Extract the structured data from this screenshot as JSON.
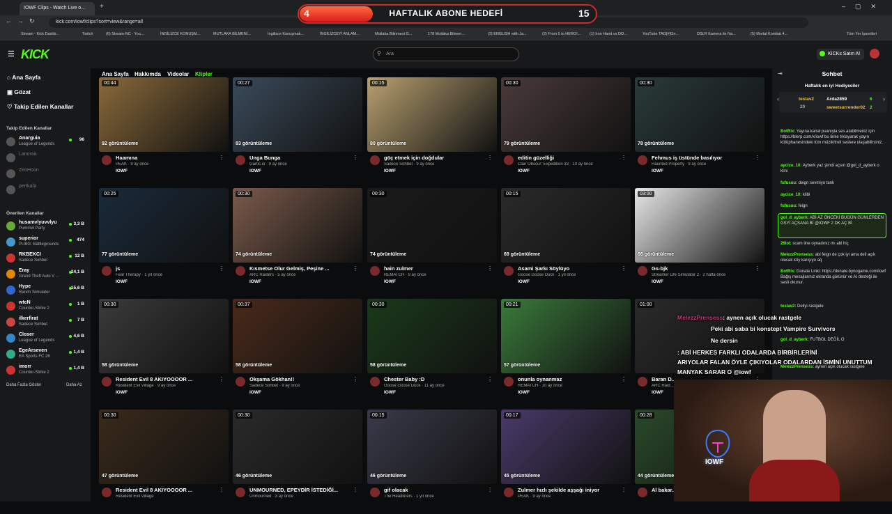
{
  "browser": {
    "tab_title": "IOWF Clips - Watch Live o...",
    "url": "kick.com/iowf/clips?sort=view&range=all",
    "bookmarks": [
      "Stream - Kick Dashb...",
      "Twitch",
      "(6) Stream-NC - You...",
      "İNGİLİZCE KONUŞM...",
      "MUTLAKA BİLMENİ...",
      "İngilizce Konuşmak...",
      "İNGİLİZCEYİ ANLAM...",
      "Mutlaka Bilinmesi G...",
      "178 Mutlaka Bilmen...",
      "(2) ENGLISH with Ja...",
      "(2) From 0 to HERO!...",
      "(1) Iron Hand vs DO...",
      "YouTube TAG[#]Ge...",
      "DSLR Kamera ile Na...",
      "(5) Mortal Kombat 4...",
      "Tüm Yer İşaretleri"
    ]
  },
  "overlay_goal": {
    "current": "4",
    "title": "HAFTALIK ABONE HEDEFİ",
    "target": "15",
    "progress": 0.27
  },
  "header": {
    "logo": "KICK",
    "search_placeholder": "Ara",
    "kicks_button": "KICKs Satın Al"
  },
  "sidebar": {
    "nav": [
      "Ana Sayfa",
      "Gözat",
      "Takip Edilen Kanallar"
    ],
    "followed_title": "Takip Edilen Kanallar",
    "followed": [
      {
        "name": "Anarguia",
        "game": "League of Legends",
        "viewers": "96",
        "live": true
      },
      {
        "name": "Lanoraa",
        "game": "",
        "viewers": "",
        "live": false
      },
      {
        "name": "ZenHoon",
        "game": "",
        "viewers": "",
        "live": false
      },
      {
        "name": "pertkafa",
        "game": "",
        "viewers": "",
        "live": false
      }
    ],
    "recommended_title": "Önerilen Kanallar",
    "recommended": [
      {
        "name": "husamvlyuvvlyu",
        "game": "Pummel Party",
        "viewers": "3,3 B"
      },
      {
        "name": "superior",
        "game": "PUBG: Battlegrounds",
        "viewers": "474"
      },
      {
        "name": "RKBEKCI",
        "game": "Sadece Sohbet",
        "viewers": "12 B"
      },
      {
        "name": "Eray",
        "game": "Grand Theft Auto V ...",
        "viewers": "24,1 B"
      },
      {
        "name": "Hype",
        "game": "Ranch Simulator",
        "viewers": "15,6 B"
      },
      {
        "name": "wtcN",
        "game": "Counter-Strike 2",
        "viewers": "1 B"
      },
      {
        "name": "ilkerfirat",
        "game": "Sadece Sohbet",
        "viewers": "7 B"
      },
      {
        "name": "Closer",
        "game": "League of Legends",
        "viewers": "4,6 B"
      },
      {
        "name": "EgeArseven",
        "game": "EA Sports FC 26",
        "viewers": "1,4 B"
      },
      {
        "name": "imorr",
        "game": "Counter-Strike 2",
        "viewers": "1,4 B"
      }
    ],
    "show_more": "Daha Fazla Göster",
    "show_less": "Daha Az"
  },
  "channel_tabs": [
    "Ana Sayfa",
    "Hakkımda",
    "Videolar",
    "Klipler"
  ],
  "clips": [
    {
      "dur": "00:44",
      "views": "92 görüntüleme",
      "title": "Haamına",
      "sub": "PEAK · 9 ay önce",
      "ch": "IOWF",
      "bg": "#8a6a3a"
    },
    {
      "dur": "00:27",
      "views": "83 görüntüleme",
      "title": "Unga Bunga",
      "sub": "Gartic.io · 9 ay önce",
      "ch": "IOWF",
      "bg": "#3a4a5a"
    },
    {
      "dur": "00:15",
      "views": "80 görüntüleme",
      "title": "göç etmek için doğdular",
      "sub": "Sadece Sohbet · 9 ay önce",
      "ch": "IOWF",
      "bg": "#b8a070"
    },
    {
      "dur": "00:30",
      "views": "79 görüntüleme",
      "title": "editin güzelliği",
      "sub": "Clair Obscur: Expedition 33 · 10 ay önce",
      "ch": "IOWF",
      "bg": "#4a3a3a"
    },
    {
      "dur": "00:30",
      "views": "78 görüntüleme",
      "title": "Fehmus iş üstünde basılıyor",
      "sub": "Haunted Property · 9 ay önce",
      "ch": "IOWF",
      "bg": "#2a3a3a"
    },
    {
      "dur": "00:25",
      "views": "77 görüntüleme",
      "title": "js",
      "sub": "Fear Therapy · 1 yıl önce",
      "ch": "IOWF",
      "bg": "#1a2a3a"
    },
    {
      "dur": "00:30",
      "views": "74 görüntüleme",
      "title": "Kısmetse Olur Gelmiş, Peşine ...",
      "sub": "ARC Raiders · 5 ay önce",
      "ch": "IOWF",
      "bg": "#7a5a4a"
    },
    {
      "dur": "00:30",
      "views": "74 görüntüleme",
      "title": "hain zulmer",
      "sub": "REMATCH · 9 ay önce",
      "ch": "IOWF",
      "bg": "#1a1a1a"
    },
    {
      "dur": "00:15",
      "views": "69 görüntüleme",
      "title": "Asami Şarkı Söylüyo",
      "sub": "Goose Goose Duck · 1 yıl önce",
      "ch": "IOWF",
      "bg": "#2a2a2a"
    },
    {
      "dur": "03:00",
      "views": "66 görüntüleme",
      "title": "Gs-bjk",
      "sub": "Streamer Life Simulator 2 · 2 hafta önce",
      "ch": "IOWF",
      "bg": "#e8e8e8"
    },
    {
      "dur": "00:30",
      "views": "58 görüntüleme",
      "title": "Resident Evil 8 AKIYOOOOR ...",
      "sub": "Resident Evil Village · 9 ay önce",
      "ch": "IOWF",
      "bg": "#3a3a3a"
    },
    {
      "dur": "00:37",
      "views": "58 görüntüleme",
      "title": "Okşama Gökhan!!",
      "sub": "Sadece Sohbet · 9 ay önce",
      "ch": "IOWF",
      "bg": "#4a2a1a"
    },
    {
      "dur": "00:30",
      "views": "58 görüntüleme",
      "title": "Chester Baby :D",
      "sub": "Goose Goose Duck · 11 ay önce",
      "ch": "IOWF",
      "bg": "#1a3a1a"
    },
    {
      "dur": "00:21",
      "views": "57 görüntüleme",
      "title": "onunla oynanmaz",
      "sub": "REMATCH · 10 ay önce",
      "ch": "IOWF",
      "bg": "#3a7a3a"
    },
    {
      "dur": "01:00",
      "views": "",
      "title": "Baran D...",
      "sub": "ARC Raid...",
      "ch": "IOWF",
      "bg": "#2a2a2a"
    },
    {
      "dur": "00:30",
      "views": "47 görüntüleme",
      "title": "Resident Evil 8 AKIYOOOOR ...",
      "sub": "Resident Evil Village",
      "ch": "",
      "bg": "#3a2a1a"
    },
    {
      "dur": "00:30",
      "views": "46 görüntüleme",
      "title": "UNMOURNED, EPEYDİR İSTEDİĞİ...",
      "sub": "Unmourned · 3 ay önce",
      "ch": "",
      "bg": "#2a2a2a"
    },
    {
      "dur": "00:15",
      "views": "46 görüntüleme",
      "title": "gif olacak",
      "sub": "The Headliners · 1 yıl önce",
      "ch": "",
      "bg": "#3a3a4a"
    },
    {
      "dur": "00:17",
      "views": "45 görüntüleme",
      "title": "Zulmer hızlı şekilde aşşağı iniyor",
      "sub": "PEAK · 9 ay önce",
      "ch": "",
      "bg": "#4a3a6a"
    },
    {
      "dur": "00:28",
      "views": "44 görüntüleme",
      "title": "Al bakar...",
      "sub": "",
      "ch": "",
      "bg": "#2a4a2a"
    }
  ],
  "chat": {
    "title": "Sohbet",
    "gifters_title": "Haftalık en iyi Hediyeciler",
    "gifters": [
      {
        "name": "teslav2",
        "n": "20"
      },
      {
        "name": "Arda2859",
        "n": "6"
      },
      {
        "name": "sweetsurrender02",
        "n": "2"
      }
    ],
    "messages": [
      {
        "u": "BotRix:",
        "t": "Yayına kanal puanıyla ses atabilmeniz için https://blerp.com/x/iowf bu linke tıklayarak yayın kütüphanesindeki tüm müzik/troll seslere ulaşabilirsiniz."
      },
      {
        "u": "aycice_10:",
        "t": "Ayberk yaz şimdi açsın @gol_d_ayberk o klini"
      },
      {
        "u": "fufusuu:",
        "t": "deign sevmiyo tank"
      },
      {
        "u": "aycice_10:",
        "t": "klibi"
      },
      {
        "u": "fufusuu:",
        "t": "feign"
      },
      {
        "u": "gol_d_ayberk:",
        "t": "ABİ AZ ÖNCEKİ BUGÜN GÜNLERDEN GSYİ AÇSANA Bİ @IOWF 2 DK AÇ Bİ"
      },
      {
        "u": "26lol:",
        "t": "scam line oynadınız mı abi hiç"
      },
      {
        "u": "MelezzPrensess:",
        "t": "abi feign de çok iyi ama deil açık olucak köy karışıyo aq"
      },
      {
        "u": "BotRix:",
        "t": "Donate Linki: https://donate.bynogame.com/iowf Bağış mesajlarınız ekranda görünür ve AI desteği ile sesli okunur."
      },
      {
        "u": "teslav2:",
        "t": "Deliyi rastgele"
      },
      {
        "u": "gol_d_ayberk:",
        "t": "FUTBOL DEĞİL O"
      },
      {
        "u": "MelezzPrensess:",
        "t": "aynen açık olucak rastgele"
      }
    ]
  },
  "stream_overlay": [
    {
      "u": "MelezzPrensess",
      "t": ": aynen açık olucak rastgele"
    },
    {
      "u": "",
      "t": "Peki abi saba bi konstept Vampire Survivors"
    },
    {
      "u": "",
      "t": "Ne dersin"
    },
    {
      "u": "",
      "t": ": ABİ HERKES FARKLI ODALARDA BİRBİRLERİNİ"
    },
    {
      "u": "",
      "t": "ARIYOLAR FALAN ÖYLE ÇIKIYOLAR ODALARDAN İSMİNİ UNUTTUM"
    },
    {
      "u": "",
      "t": "MANYAK SARAR O @iowf"
    }
  ],
  "webcam_sign": "IOWF"
}
